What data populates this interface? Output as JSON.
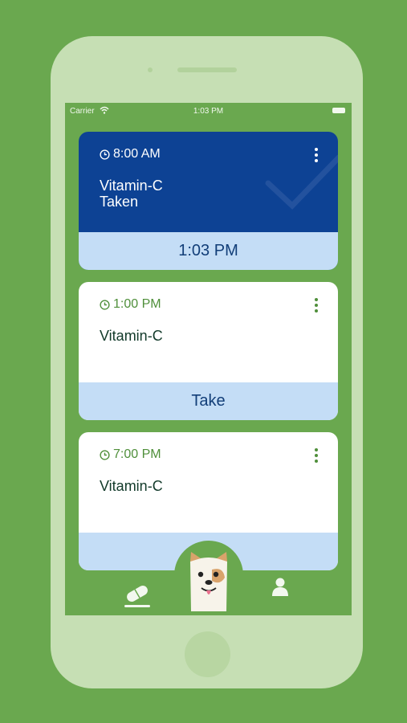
{
  "status_bar": {
    "carrier": "Carrier",
    "time": "1:03 PM",
    "wifi_icon": "wifi-icon",
    "battery_icon": "battery-icon"
  },
  "cards": [
    {
      "time": "8:00 AM",
      "name": "Vitamin-C\nTaken",
      "action": "1:03 PM",
      "state": "taken"
    },
    {
      "time": "1:00 PM",
      "name": "Vitamin-C",
      "action": "Take",
      "state": "pending"
    },
    {
      "time": "7:00 PM",
      "name": "Vitamin-C",
      "action": "",
      "state": "pending"
    }
  ],
  "tab_bar": {
    "items": [
      {
        "icon": "pill-icon",
        "active": true
      },
      {
        "icon": "dog-mascot-icon",
        "active": false
      },
      {
        "icon": "user-icon",
        "active": false
      }
    ]
  },
  "colors": {
    "background": "#6aa84f",
    "card_taken": "#0d4294",
    "action_bar": "#c4ddf6",
    "accent_green": "#4f8f3a"
  }
}
